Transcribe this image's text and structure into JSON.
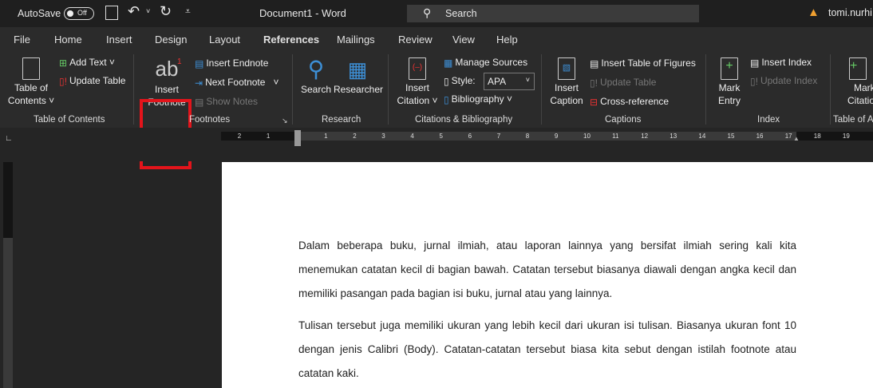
{
  "titlebar": {
    "autosave_label": "AutoSave",
    "autosave_state": "Off",
    "document_title": "Document1  -  Word",
    "search_placeholder": "Search",
    "user": "tomi.nurhi"
  },
  "tabs": [
    "File",
    "Home",
    "Insert",
    "Design",
    "Layout",
    "References",
    "Mailings",
    "Review",
    "View",
    "Help"
  ],
  "active_tab": "References",
  "ribbon": {
    "toc": {
      "table_of_contents": [
        "Table of",
        "Contents ˅"
      ],
      "add_text": "Add Text ˅",
      "update_table": "Update Table",
      "group": "Table of Contents"
    },
    "footnotes": {
      "insert_footnote": [
        "Insert",
        "Footnote"
      ],
      "icon_text": "ab",
      "icon_sup": "1",
      "insert_endnote": "Insert Endnote",
      "next_footnote": "Next Footnote",
      "show_notes": "Show Notes",
      "group": "Footnotes"
    },
    "research": {
      "search": "Search",
      "researcher": "Researcher",
      "group": "Research"
    },
    "citations": {
      "insert_citation": [
        "Insert",
        "Citation ˅"
      ],
      "manage_sources": "Manage Sources",
      "style_label": "Style:",
      "style_value": "APA",
      "bibliography": "Bibliography ˅",
      "group": "Citations & Bibliography"
    },
    "captions": {
      "insert_caption": [
        "Insert",
        "Caption"
      ],
      "insert_table_of_figures": "Insert Table of Figures",
      "update_table": "Update Table",
      "cross_reference": "Cross-reference",
      "group": "Captions"
    },
    "index": {
      "mark_entry": [
        "Mark",
        "Entry"
      ],
      "insert_index": "Insert Index",
      "update_index": "Update Index",
      "group": "Index"
    },
    "toa": {
      "mark_citation": [
        "Mark",
        "Citatio"
      ],
      "group": "Table of A"
    }
  },
  "ruler": {
    "left": [
      "2",
      "1"
    ],
    "main": [
      "1",
      "2",
      "3",
      "4",
      "5",
      "6",
      "7",
      "8",
      "9",
      "10",
      "11",
      "12",
      "13",
      "14",
      "15",
      "16"
    ],
    "right": [
      "17",
      "18",
      "19"
    ]
  },
  "document": {
    "paragraphs": [
      "Dalam beberapa buku, jurnal ilmiah, atau laporan lainnya yang bersifat ilmiah sering kali kita menemukan catatan kecil di bagian bawah. Catatan tersebut biasanya diawali dengan angka kecil dan memiliki pasangan pada bagian isi buku, jurnal atau yang lainnya.",
      "Tulisan tersebut juga memiliki ukuran yang lebih kecil dari ukuran isi tulisan. Biasanya ukuran font 10 dengan jenis Calibri (Body). Catatan-catatan tersebut biasa kita sebut dengan istilah footnote atau catatan kaki."
    ]
  },
  "colors": {
    "highlight": "#e3141b",
    "accent_blue": "#3d8fd6",
    "warning": "#f0a030"
  }
}
